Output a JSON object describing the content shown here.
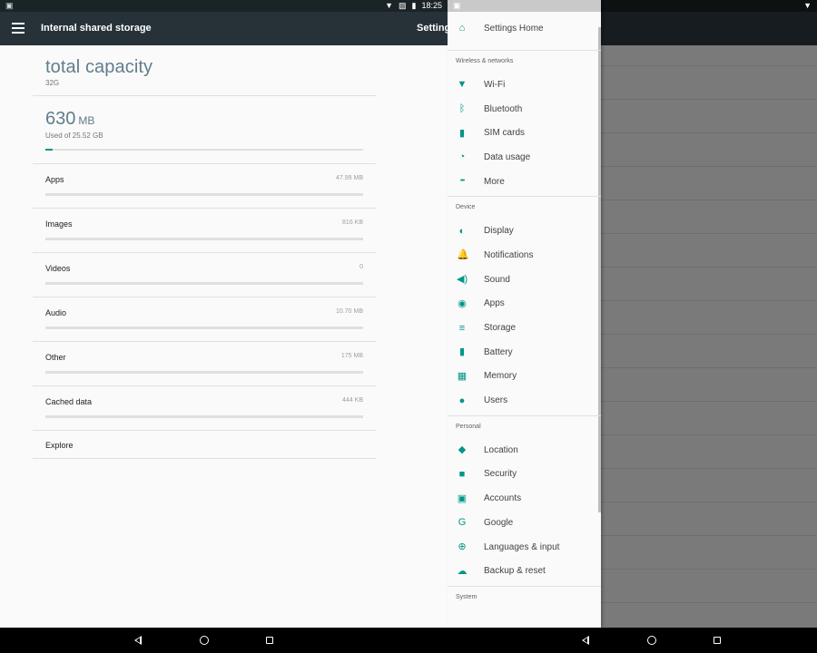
{
  "status_bar": {
    "time": "18:25"
  },
  "toolbar": {
    "title": "Internal shared storage",
    "trailing_title": "Settings"
  },
  "storage": {
    "total_title": "total capacity",
    "total_value": "32G",
    "used_number": "630",
    "used_unit": "MB",
    "used_caption": "Used of 25.52 GB",
    "used_fraction": 0.024,
    "categories": [
      {
        "label": "Apps",
        "size": "47.99 MB"
      },
      {
        "label": "Images",
        "size": "816 KB"
      },
      {
        "label": "Videos",
        "size": "0"
      },
      {
        "label": "Audio",
        "size": "10.70 MB"
      },
      {
        "label": "Other",
        "size": "175 MB"
      },
      {
        "label": "Cached data",
        "size": "444 KB"
      }
    ],
    "explore_label": "Explore"
  },
  "drawer": {
    "home_label": "Settings Home",
    "sections": [
      {
        "title": "Wireless & networks",
        "items": [
          {
            "label": "Wi-Fi",
            "icon": "wifi-icon"
          },
          {
            "label": "Bluetooth",
            "icon": "bluetooth-icon"
          },
          {
            "label": "SIM cards",
            "icon": "sim-card-icon"
          },
          {
            "label": "Data usage",
            "icon": "data-usage-icon"
          },
          {
            "label": "More",
            "icon": "more-icon"
          }
        ]
      },
      {
        "title": "Device",
        "items": [
          {
            "label": "Display",
            "icon": "display-icon"
          },
          {
            "label": "Notifications",
            "icon": "bell-icon"
          },
          {
            "label": "Sound",
            "icon": "volume-icon"
          },
          {
            "label": "Apps",
            "icon": "android-icon"
          },
          {
            "label": "Storage",
            "icon": "storage-icon"
          },
          {
            "label": "Battery",
            "icon": "battery-icon"
          },
          {
            "label": "Memory",
            "icon": "memory-icon"
          },
          {
            "label": "Users",
            "icon": "person-icon"
          }
        ]
      },
      {
        "title": "Personal",
        "items": [
          {
            "label": "Location",
            "icon": "location-pin-icon"
          },
          {
            "label": "Security",
            "icon": "lock-icon"
          },
          {
            "label": "Accounts",
            "icon": "account-box-icon"
          },
          {
            "label": "Google",
            "icon": "google-icon"
          },
          {
            "label": "Languages & input",
            "icon": "globe-icon"
          },
          {
            "label": "Backup & reset",
            "icon": "cloud-upload-icon"
          }
        ]
      },
      {
        "title": "System",
        "items": []
      }
    ]
  },
  "colors": {
    "accent": "#009688",
    "toolbar": "#263238",
    "title_text": "#607d8b"
  }
}
